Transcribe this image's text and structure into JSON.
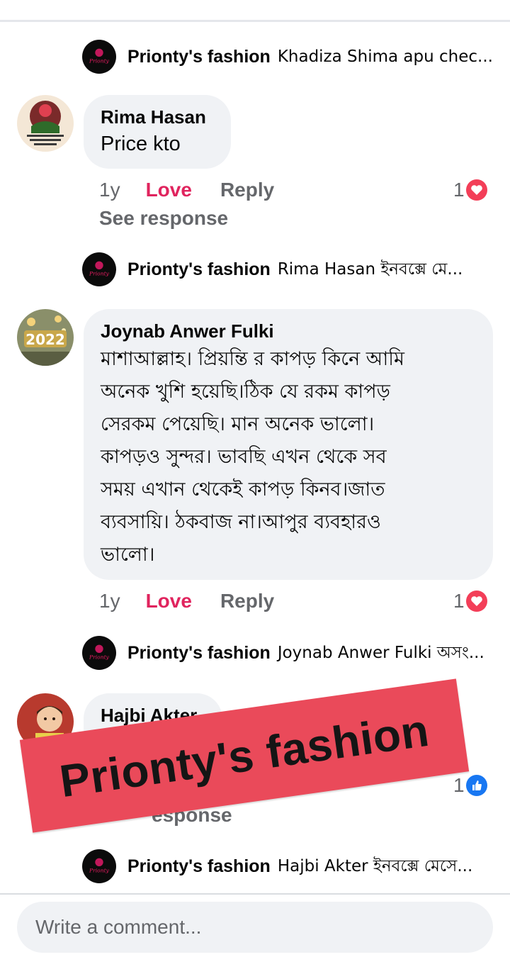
{
  "page_name": "Prionty's fashion",
  "replies": [
    {
      "name": "Prionty's fashion",
      "text": "Khadiza Shima apu chec..."
    },
    {
      "name": "Prionty's fashion",
      "text": "Rima Hasan ইনবক্সে মে..."
    },
    {
      "name": "Prionty's fashion",
      "text": "Joynab Anwer Fulki অসং..."
    },
    {
      "name": "Prionty's fashion",
      "text": "Hajbi Akter ইনবক্সে মেসে..."
    }
  ],
  "comments": [
    {
      "name": "Rima Hasan",
      "text": "Price kto",
      "time": "1y",
      "love_label": "Love",
      "reply_label": "Reply",
      "reaction_count": "1",
      "reaction": "heart-icon",
      "see_response": "See response"
    },
    {
      "name": "Joynab Anwer Fulki",
      "lines": [
        "মাশাআল্লাহ। প্রিয়ন্তি  র কাপড় কিনে আমি",
        "অনেক খুশি হয়েছি।ঠিক  যে রকম কাপড়",
        "সেরকম পেয়েছি। মান অনেক ভালো।",
        "কাপড়ও সুন্দর। ভাবছি এখন থেকে সব",
        "সময়  এখান থেকেই  কাপড় কিনব।জাত",
        "ব্যবসায়ি। ঠকবাজ না।আপুর ব্যবহারও",
        "ভালো।"
      ],
      "time": "1y",
      "love_label": "Love",
      "reply_label": "Reply",
      "reaction_count": "1",
      "reaction": "heart-icon"
    },
    {
      "name": "Hajbi Akter",
      "reaction_count": "1",
      "reaction": "like-icon",
      "see_response_partial": "esponse"
    }
  ],
  "watermark": "Prionty's fashion",
  "composer": {
    "placeholder": "Write a comment..."
  },
  "colors": {
    "love": "#e0245e",
    "heart": "#f33e58",
    "like": "#1877f2",
    "banner": "#ea4a5a",
    "bubble": "#f0f2f5"
  }
}
